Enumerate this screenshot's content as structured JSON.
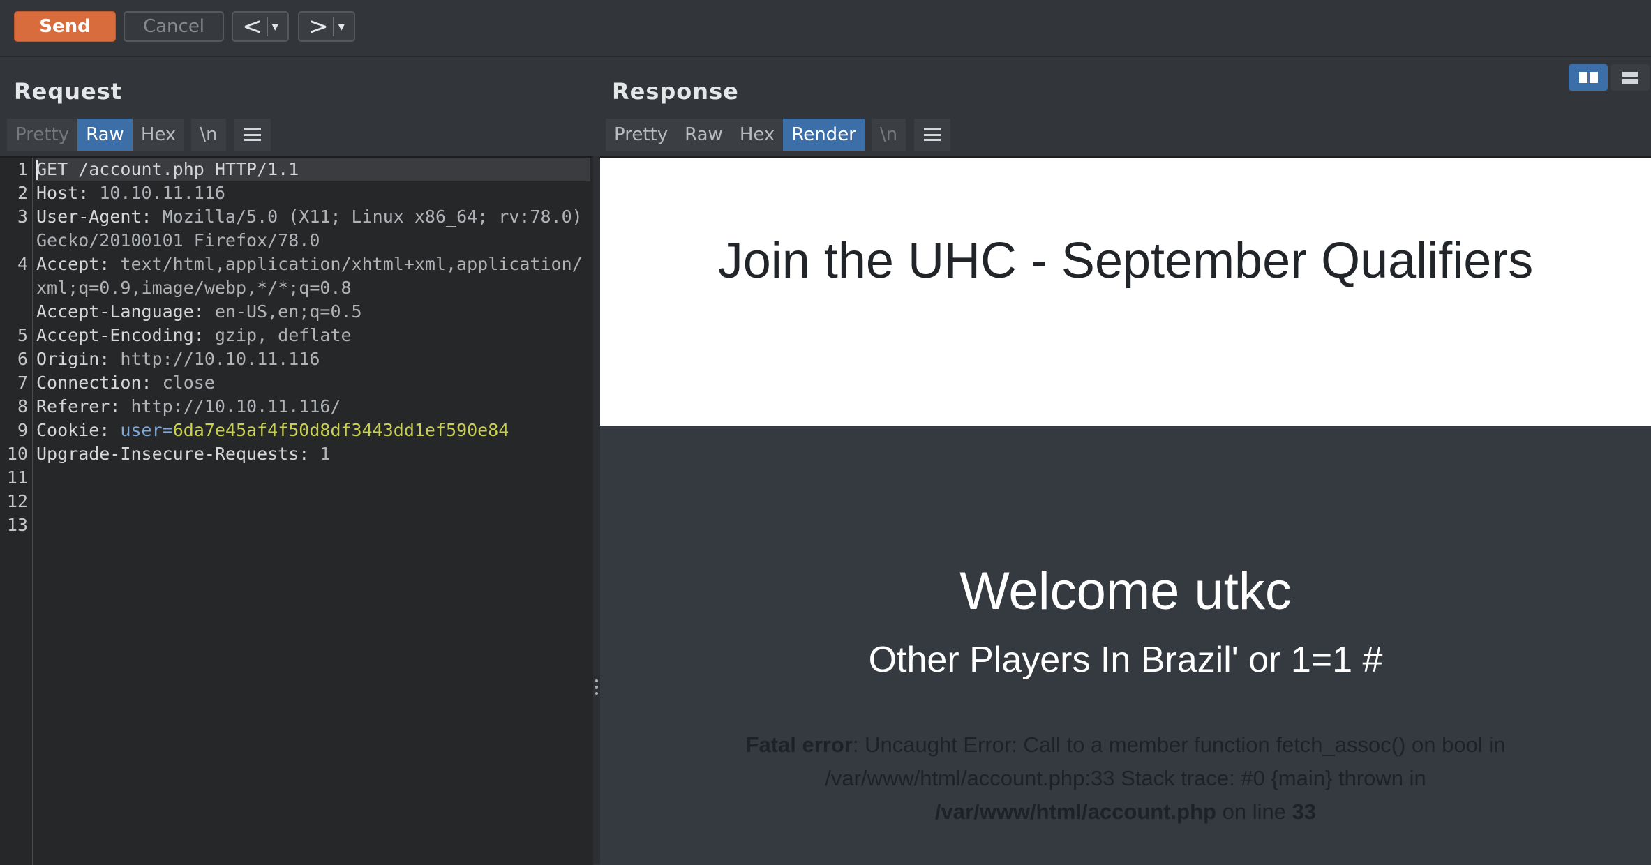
{
  "toolbar": {
    "send_label": "Send",
    "cancel_label": "Cancel",
    "back_label": "<",
    "forward_label": ">",
    "dropdown_glyph": "▾"
  },
  "request": {
    "title": "Request",
    "tabs": [
      "Pretty",
      "Raw",
      "Hex",
      "\\n"
    ],
    "active_tab": "Raw",
    "lines": [
      {
        "n": "1",
        "key": "GET /account.php HTTP/1.1",
        "val": ""
      },
      {
        "n": "2",
        "key": "Host:",
        "val": " 10.10.11.116"
      },
      {
        "n": "3",
        "key": "User-Agent:",
        "val": " Mozilla/5.0 (X11; Linux x86_64; rv:78.0) Gecko/20100101 Firefox/78.0"
      },
      {
        "n": "4",
        "key": "Accept:",
        "val": " text/html,application/xhtml+xml,application/xml;q=0.9,image/webp,*/*;q=0.8"
      },
      {
        "n": "5",
        "key": "Accept-Language:",
        "val": " en-US,en;q=0.5"
      },
      {
        "n": "6",
        "key": "Accept-Encoding:",
        "val": " gzip, deflate"
      },
      {
        "n": "7",
        "key": "Origin:",
        "val": " http://10.10.11.116"
      },
      {
        "n": "8",
        "key": "Connection:",
        "val": " close"
      },
      {
        "n": "9",
        "key": "Referer:",
        "val": " http://10.10.11.116/"
      },
      {
        "n": "10",
        "key": "Cookie:",
        "val": " ",
        "cookie_name": "user=",
        "cookie_value": "6da7e45af4f50d8df3443dd1ef590e84"
      },
      {
        "n": "11",
        "key": "Upgrade-Insecure-Requests:",
        "val": " 1"
      },
      {
        "n": "12",
        "key": "",
        "val": ""
      },
      {
        "n": "13",
        "key": "",
        "val": ""
      }
    ]
  },
  "response": {
    "title": "Response",
    "tabs": [
      "Pretty",
      "Raw",
      "Hex",
      "Render",
      "\\n"
    ],
    "active_tab": "Render",
    "render": {
      "header_title": "Join the UHC - September Qualifiers",
      "welcome": "Welcome utkc",
      "players": "Other Players In Brazil' or 1=1 #",
      "fatal_label": "Fatal error",
      "fatal_msg": ": Uncaught Error: Call to a member function fetch_assoc() on bool in /var/www/html/account.php:33 Stack trace: #0 {main} thrown in ",
      "fatal_file": "/var/www/html/account.php",
      "fatal_online": " on line ",
      "fatal_line": "33"
    }
  },
  "colors": {
    "send": "#d96c3d",
    "active_tab": "#3c6ea8",
    "cookie_value": "#c8cf52",
    "background": "#323539"
  }
}
